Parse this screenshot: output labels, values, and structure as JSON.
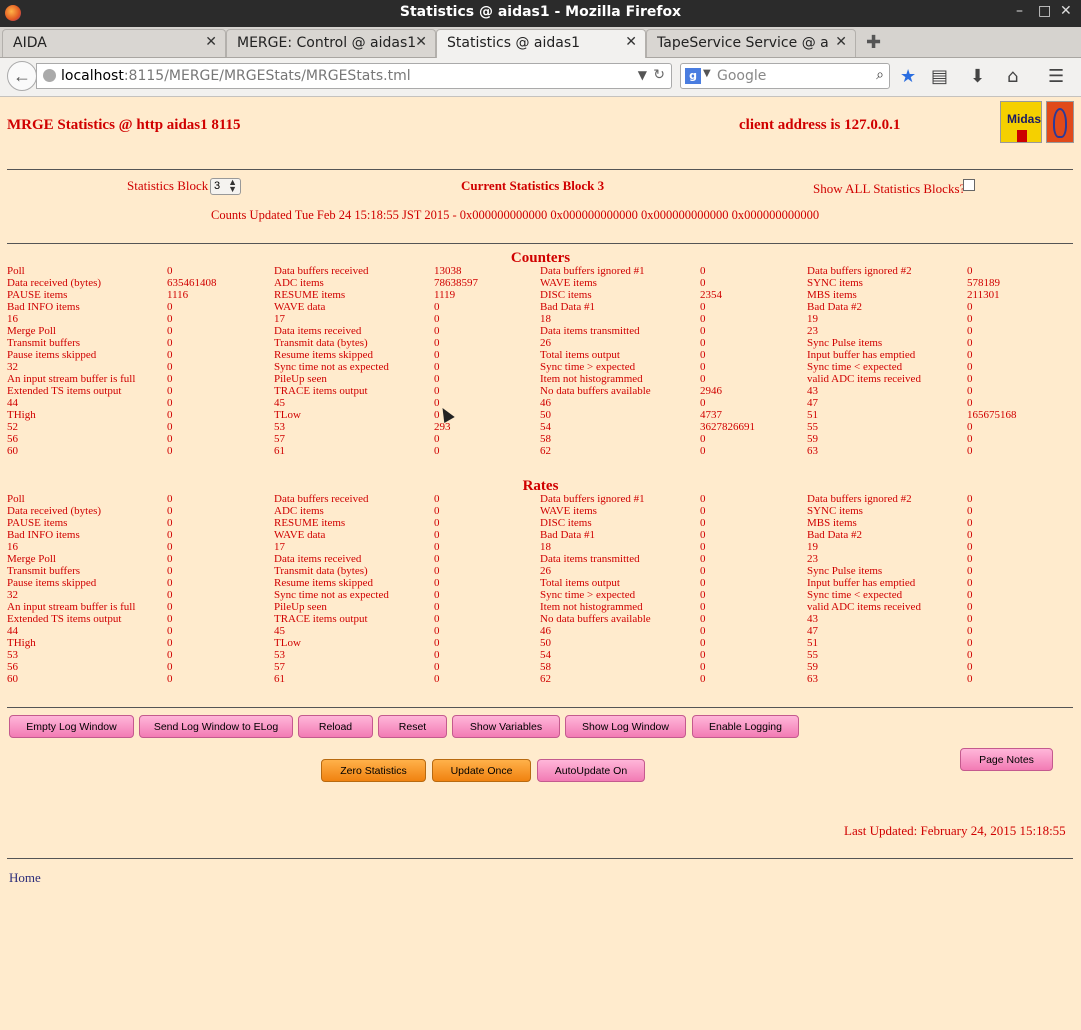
{
  "window": {
    "title": "Statistics @ aidas1 - Mozilla Firefox",
    "controls": [
      "–",
      "□",
      "✕"
    ]
  },
  "tabs": [
    {
      "label": "AIDA"
    },
    {
      "label": "MERGE: Control @ aidas1"
    },
    {
      "label": "Statistics @ aidas1"
    },
    {
      "label": "TapeService Service @ a…"
    }
  ],
  "nav": {
    "url_host": "localhost",
    "url_path": ":8115/MERGE/MRGEStats/MRGEStats.tml",
    "search_placeholder": "Google"
  },
  "header": {
    "title": "MRGE Statistics @ http aidas1 8115",
    "client": "client address is 127.0.0.1",
    "logo_text": "Midas"
  },
  "controls": {
    "stats_block_label": "Statistics Block",
    "stats_block_value": "3",
    "current_block": "Current Statistics Block 3",
    "show_all_label": "Show ALL Statistics Blocks?",
    "counts_updated": "Counts Updated Tue Feb 24 15:18:55 JST 2015 - 0x000000000000 0x000000000000 0x000000000000 0x000000000000"
  },
  "counters": {
    "title": "Counters",
    "rows": [
      [
        "Poll",
        "0",
        "Data buffers received",
        "13038",
        "Data buffers ignored #1",
        "0",
        "Data buffers ignored #2",
        "0"
      ],
      [
        "Data received (bytes)",
        "635461408",
        "ADC items",
        "78638597",
        "WAVE items",
        "0",
        "SYNC items",
        "578189"
      ],
      [
        "PAUSE items",
        "1116",
        "RESUME items",
        "1119",
        "DISC items",
        "2354",
        "MBS items",
        "211301"
      ],
      [
        "Bad INFO items",
        "0",
        "WAVE data",
        "0",
        "Bad Data #1",
        "0",
        "Bad Data #2",
        "0"
      ],
      [
        "16",
        "0",
        "17",
        "0",
        "18",
        "0",
        "19",
        "0"
      ],
      [
        "Merge Poll",
        "0",
        "Data items received",
        "0",
        "Data items transmitted",
        "0",
        "23",
        "0"
      ],
      [
        "Transmit buffers",
        "0",
        "Transmit data (bytes)",
        "0",
        "26",
        "0",
        "Sync Pulse items",
        "0"
      ],
      [
        "Pause items skipped",
        "0",
        "Resume items skipped",
        "0",
        "Total items output",
        "0",
        "Input buffer has emptied",
        "0"
      ],
      [
        "32",
        "0",
        "Sync time not as expected",
        "0",
        "Sync time > expected",
        "0",
        "Sync time < expected",
        "0"
      ],
      [
        "An input stream buffer is full",
        "0",
        "PileUp seen",
        "0",
        "Item not histogrammed",
        "0",
        "valid ADC items received",
        "0"
      ],
      [
        "Extended TS items output",
        "0",
        "TRACE items output",
        "0",
        "No data buffers available",
        "2946",
        "43",
        "0"
      ],
      [
        "44",
        "0",
        "45",
        "0",
        "46",
        "0",
        "47",
        "0"
      ],
      [
        "THigh",
        "0",
        "TLow",
        "0",
        "50",
        "4737",
        "51",
        "165675168"
      ],
      [
        "52",
        "0",
        "53",
        "293",
        "54",
        "3627826691",
        "55",
        "0"
      ],
      [
        "56",
        "0",
        "57",
        "0",
        "58",
        "0",
        "59",
        "0"
      ],
      [
        "60",
        "0",
        "61",
        "0",
        "62",
        "0",
        "63",
        "0"
      ]
    ]
  },
  "rates": {
    "title": "Rates",
    "rows": [
      [
        "Poll",
        "0",
        "Data buffers received",
        "0",
        "Data buffers ignored #1",
        "0",
        "Data buffers ignored #2",
        "0"
      ],
      [
        "Data received (bytes)",
        "0",
        "ADC items",
        "0",
        "WAVE items",
        "0",
        "SYNC items",
        "0"
      ],
      [
        "PAUSE items",
        "0",
        "RESUME items",
        "0",
        "DISC items",
        "0",
        "MBS items",
        "0"
      ],
      [
        "Bad INFO items",
        "0",
        "WAVE data",
        "0",
        "Bad Data #1",
        "0",
        "Bad Data #2",
        "0"
      ],
      [
        "16",
        "0",
        "17",
        "0",
        "18",
        "0",
        "19",
        "0"
      ],
      [
        "Merge Poll",
        "0",
        "Data items received",
        "0",
        "Data items transmitted",
        "0",
        "23",
        "0"
      ],
      [
        "Transmit buffers",
        "0",
        "Transmit data (bytes)",
        "0",
        "26",
        "0",
        "Sync Pulse items",
        "0"
      ],
      [
        "Pause items skipped",
        "0",
        "Resume items skipped",
        "0",
        "Total items output",
        "0",
        "Input buffer has emptied",
        "0"
      ],
      [
        "32",
        "0",
        "Sync time not as expected",
        "0",
        "Sync time > expected",
        "0",
        "Sync time < expected",
        "0"
      ],
      [
        "An input stream buffer is full",
        "0",
        "PileUp seen",
        "0",
        "Item not histogrammed",
        "0",
        "valid ADC items received",
        "0"
      ],
      [
        "Extended TS items output",
        "0",
        "TRACE items output",
        "0",
        "No data buffers available",
        "0",
        "43",
        "0"
      ],
      [
        "44",
        "0",
        "45",
        "0",
        "46",
        "0",
        "47",
        "0"
      ],
      [
        "THigh",
        "0",
        "TLow",
        "0",
        "50",
        "0",
        "51",
        "0"
      ],
      [
        "53",
        "0",
        "53",
        "0",
        "54",
        "0",
        "55",
        "0"
      ],
      [
        "56",
        "0",
        "57",
        "0",
        "58",
        "0",
        "59",
        "0"
      ],
      [
        "60",
        "0",
        "61",
        "0",
        "62",
        "0",
        "63",
        "0"
      ]
    ]
  },
  "buttons": {
    "empty_log": "Empty Log Window",
    "send_log": "Send Log Window to ELog",
    "reload": "Reload",
    "reset": "Reset",
    "show_variables": "Show Variables",
    "show_log": "Show Log Window",
    "enable_logging": "Enable Logging",
    "page_notes": "Page Notes",
    "zero_stats": "Zero Statistics",
    "update_once": "Update Once",
    "autoupdate": "AutoUpdate On"
  },
  "footer": {
    "last_updated": "Last Updated: February 24, 2015 15:18:55",
    "home": "Home"
  },
  "colors": {
    "page_bg": "#ffebcd",
    "text": "#d00000",
    "pink_button": "#f27bb4",
    "orange_button": "#f08210",
    "link": "#2d2d7a"
  }
}
